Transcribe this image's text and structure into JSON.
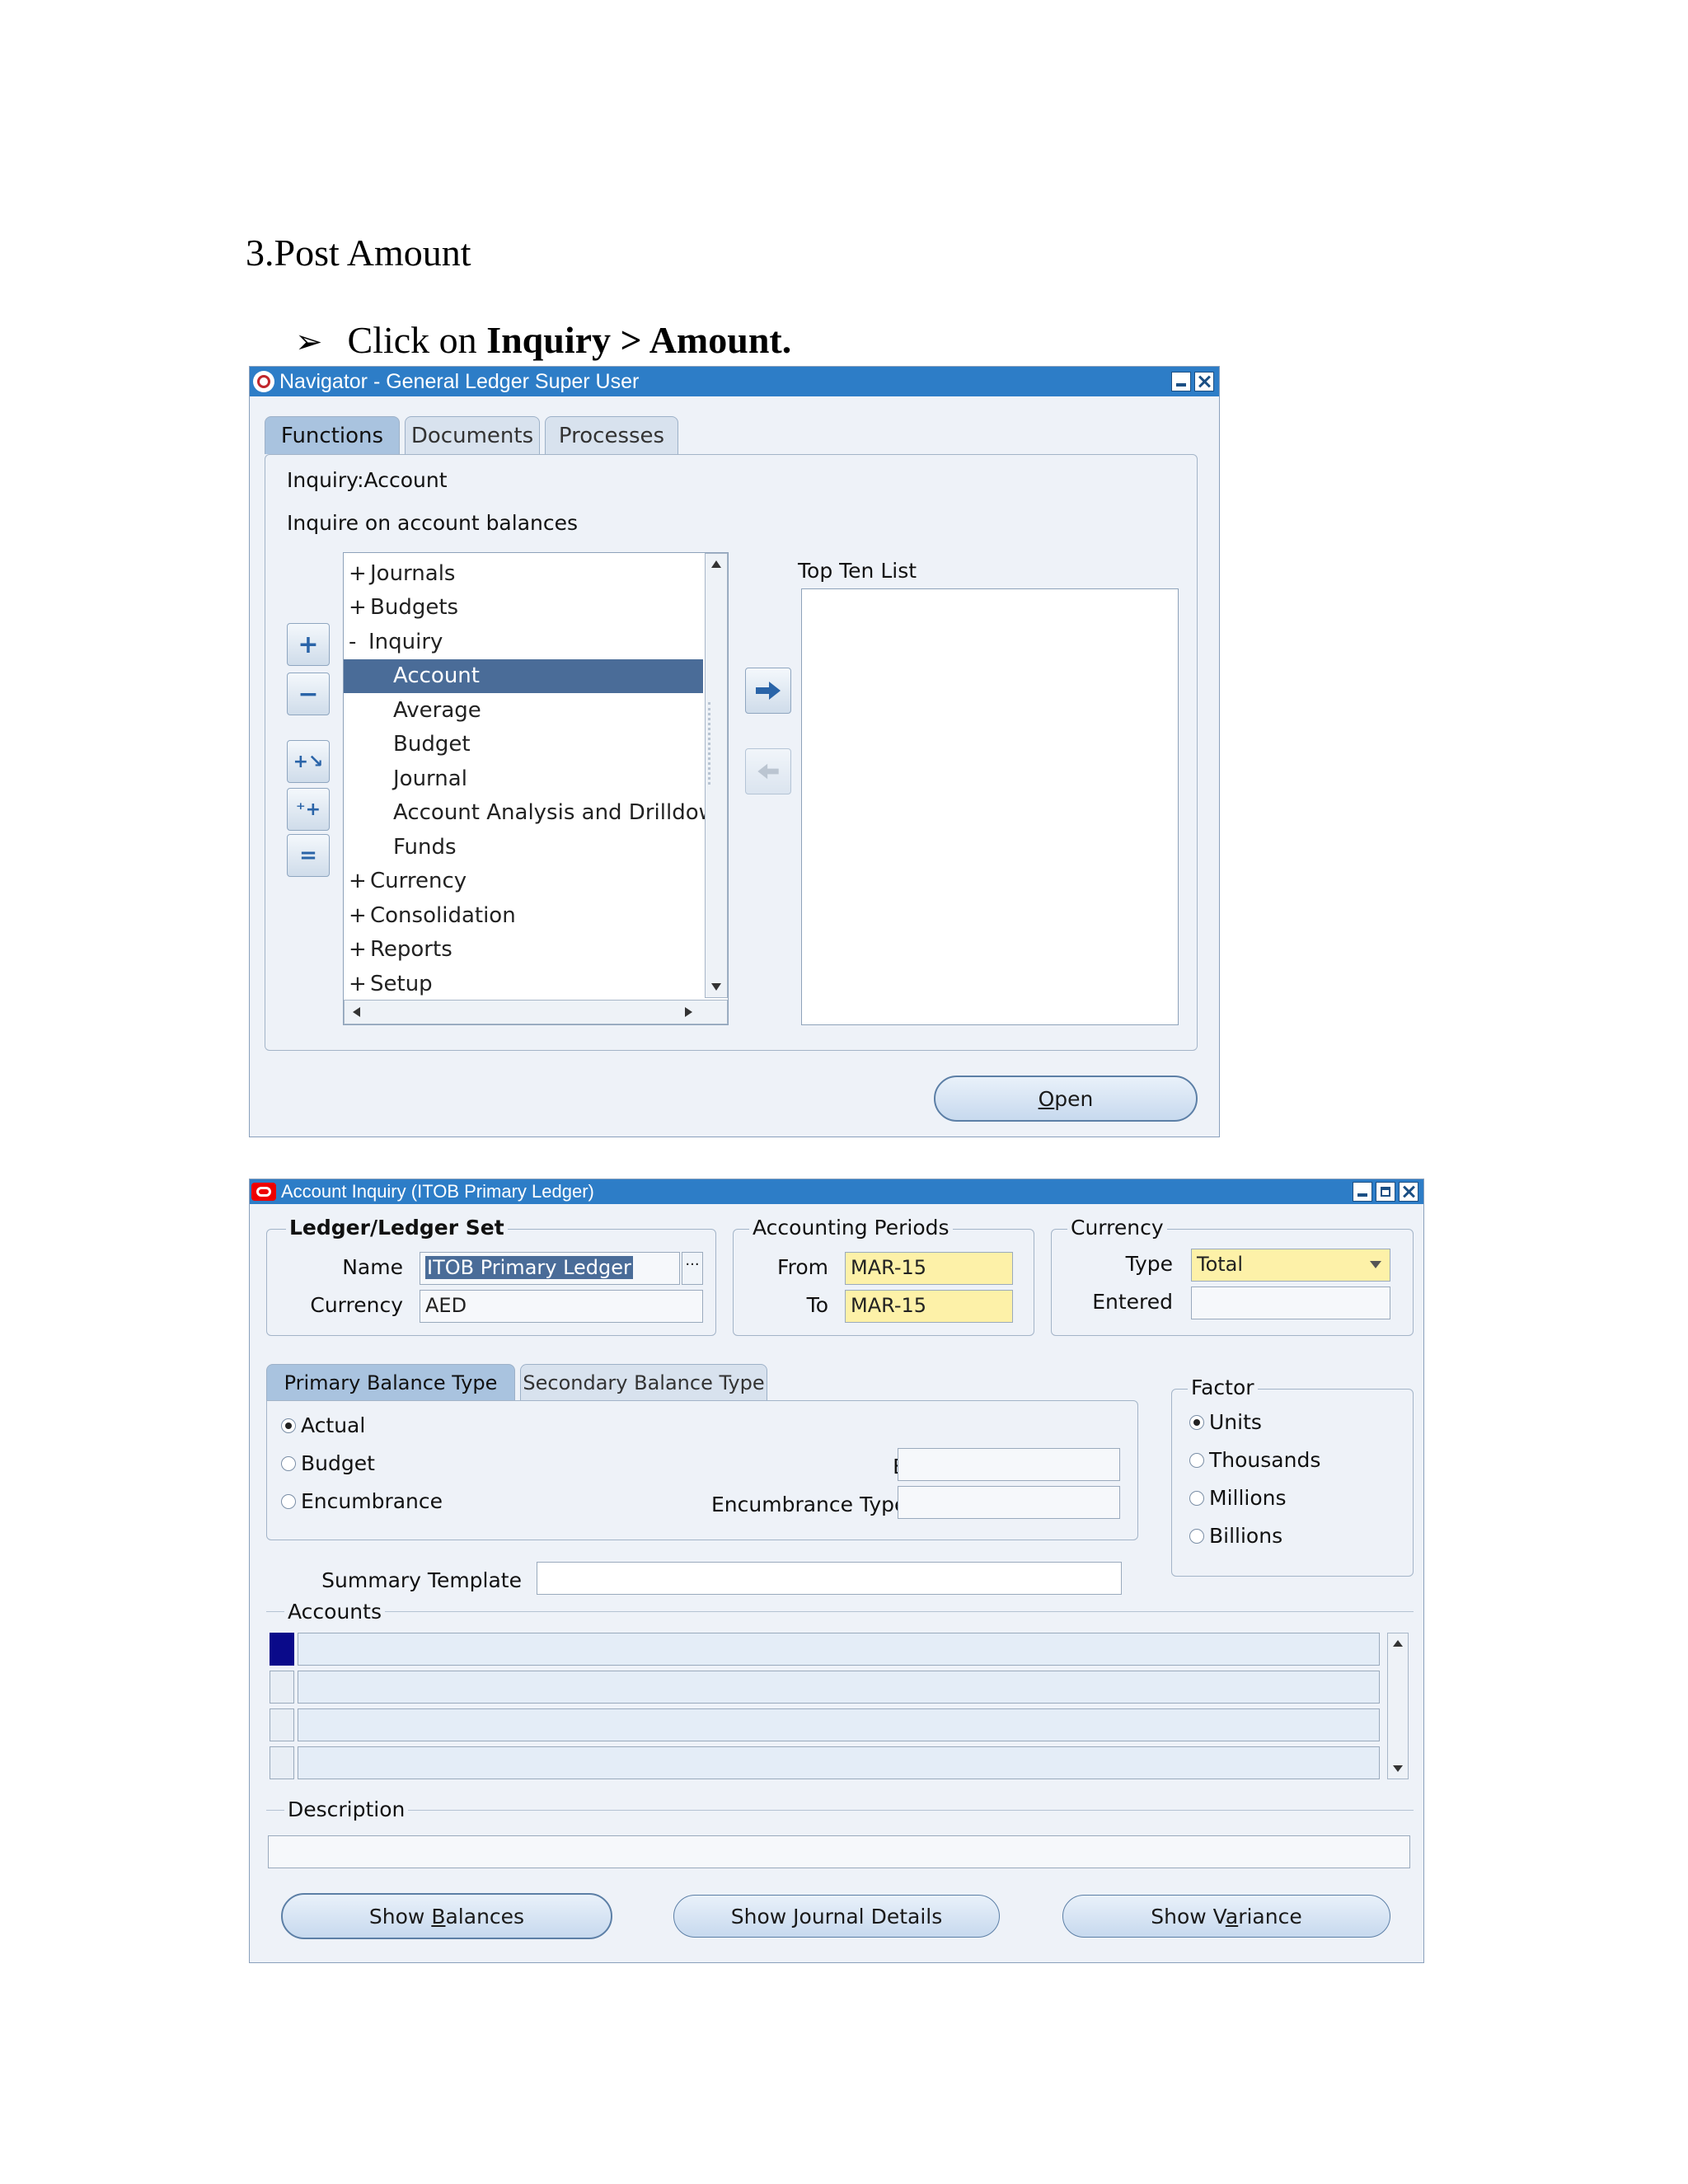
{
  "document": {
    "heading": "3.Post Amount",
    "bullet_prefix": "Click on ",
    "bullet_bold": "Inquiry > Amount."
  },
  "navigator": {
    "title": "Navigator - General Ledger Super User",
    "tabs": [
      "Functions",
      "Documents",
      "Processes"
    ],
    "selected_function": "Inquiry:Account",
    "selected_description": "Inquire on account balances",
    "tree": [
      {
        "prefix": "+",
        "label": "Journals"
      },
      {
        "prefix": "+",
        "label": "Budgets"
      },
      {
        "prefix": "-",
        "label": "Inquiry"
      },
      {
        "prefix": "",
        "label": "Account",
        "selected": true
      },
      {
        "prefix": "",
        "label": "Average"
      },
      {
        "prefix": "",
        "label": "Budget"
      },
      {
        "prefix": "",
        "label": "Journal"
      },
      {
        "prefix": "",
        "label": "Account Analysis and Drilldown"
      },
      {
        "prefix": "",
        "label": "Funds"
      },
      {
        "prefix": "+",
        "label": "Currency"
      },
      {
        "prefix": "+",
        "label": "Consolidation"
      },
      {
        "prefix": "+",
        "label": "Reports"
      },
      {
        "prefix": "+",
        "label": "Setup"
      }
    ],
    "top_ten_label": "Top Ten List",
    "open_button": "Open",
    "open_mnemonic": "O",
    "open_rest": "pen"
  },
  "account_inquiry": {
    "title": "Account Inquiry (ITOB Primary Ledger)",
    "ledger_group_label": "Ledger/Ledger Set",
    "name_label": "Name",
    "name_value": "ITOB Primary Ledger",
    "currency_label": "Currency",
    "currency_value": "AED",
    "periods_group_label": "Accounting Periods",
    "from_label": "From",
    "from_value": "MAR-15",
    "to_label": "To",
    "to_value": "MAR-15",
    "currency_group_label": "Currency",
    "type_label": "Type",
    "type_value": "Total",
    "entered_label": "Entered",
    "entered_value": "",
    "balance_tabs": [
      "Primary Balance Type",
      "Secondary Balance Type"
    ],
    "balance_options": [
      "Actual",
      "Budget",
      "Encumbrance"
    ],
    "balance_selected": "Actual",
    "budget_label": "Budget",
    "encumbrance_type_label": "Encumbrance Type",
    "factor_label": "Factor",
    "factor_options": [
      "Units",
      "Thousands",
      "Millions",
      "Billions"
    ],
    "factor_selected": "Units",
    "summary_template_label": "Summary Template",
    "accounts_label": "Accounts",
    "description_label": "Description",
    "buttons": {
      "show_balances": {
        "pre": "Show ",
        "mn": "B",
        "post": "alances"
      },
      "show_journal_details": {
        "pre": "Show ",
        "mn": "J",
        "post": "ournal Details"
      },
      "show_variance": {
        "pre": "Show V",
        "mn": "a",
        "post": "riance"
      }
    }
  },
  "colors": {
    "titlebar": "#2d7dc7",
    "selection": "#4a6c98",
    "required_field": "#fdf1a8"
  }
}
